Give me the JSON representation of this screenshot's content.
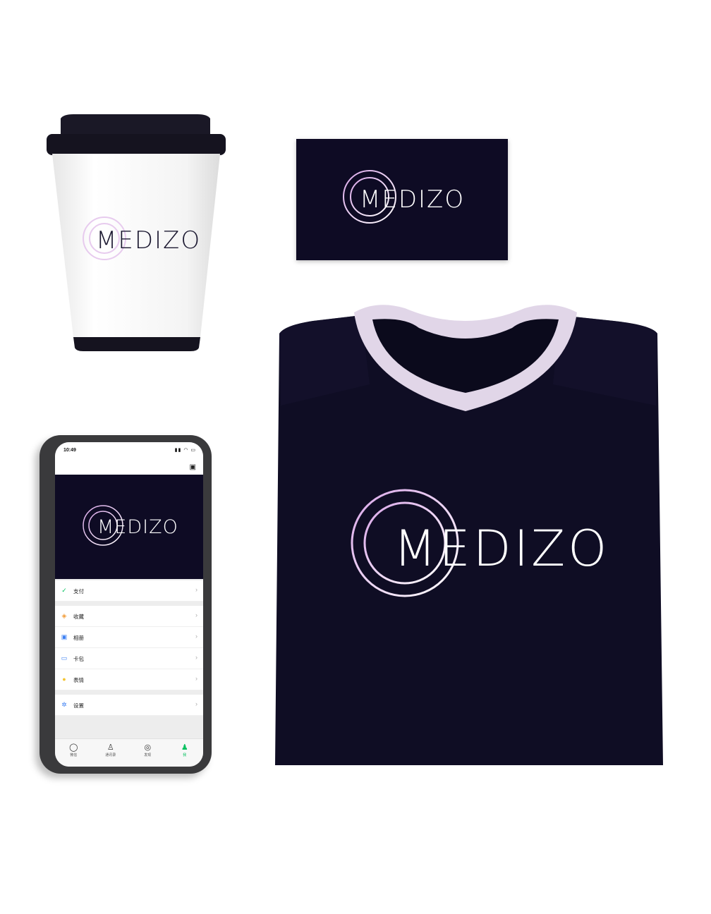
{
  "brand": {
    "name": "MEDIZO",
    "primary_color": "#0e0b24",
    "accent_color": "#e6c6ef",
    "logo_gradient": [
      "#d9a6e8",
      "#ffffff"
    ]
  },
  "phone": {
    "status_time": "10:49",
    "menu": [
      {
        "label": "支付",
        "icon": "pay-icon",
        "color": "#07c160"
      },
      {
        "label": "收藏",
        "icon": "favorites-icon",
        "color": "#f29c38"
      },
      {
        "label": "相册",
        "icon": "album-icon",
        "color": "#3b7ff2"
      },
      {
        "label": "卡包",
        "icon": "card-icon",
        "color": "#3b7ff2"
      },
      {
        "label": "表情",
        "icon": "sticker-icon",
        "color": "#f4c431"
      },
      {
        "label": "设置",
        "icon": "settings-icon",
        "color": "#3b7ff2"
      }
    ],
    "tabs": [
      {
        "label": "微信",
        "icon": "chat-icon"
      },
      {
        "label": "通讯录",
        "icon": "contacts-icon"
      },
      {
        "label": "发现",
        "icon": "discover-icon"
      },
      {
        "label": "我",
        "icon": "me-icon",
        "active": true
      }
    ]
  }
}
